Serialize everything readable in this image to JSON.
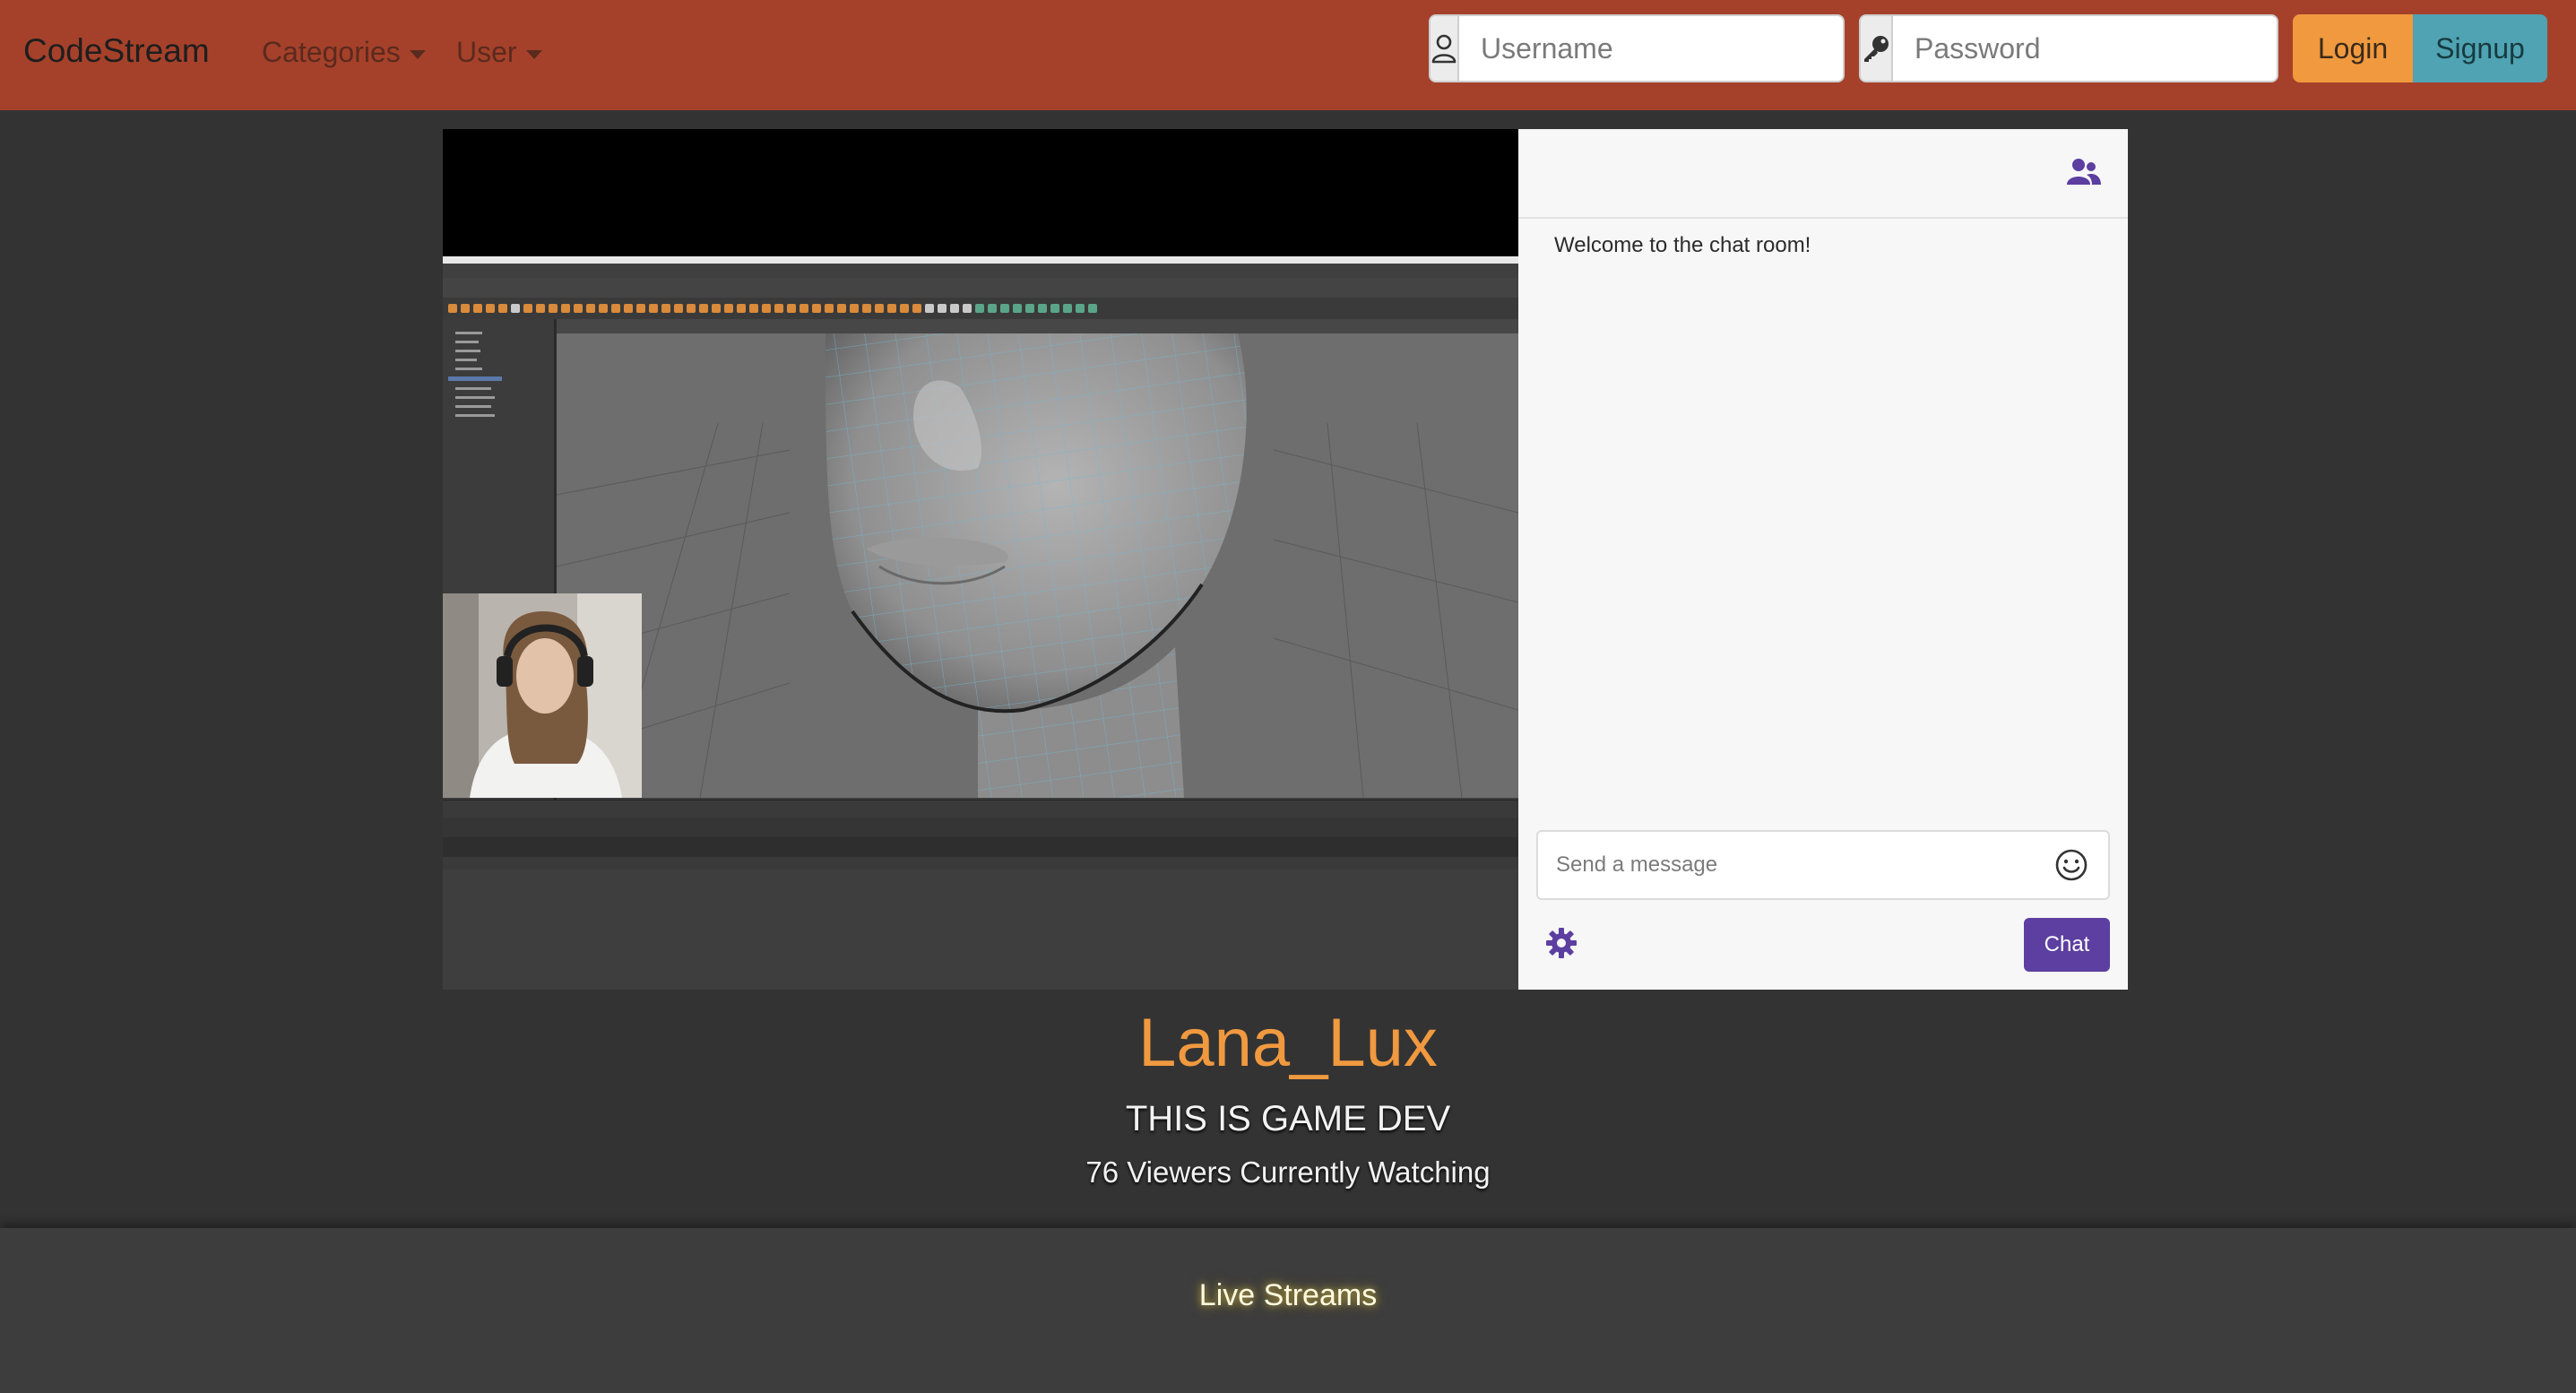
{
  "navbar": {
    "brand": "CodeStream",
    "categories_label": "Categories",
    "user_label": "User",
    "username_placeholder": "Username",
    "password_placeholder": "Password",
    "login_label": "Login",
    "signup_label": "Signup",
    "bg_color": "#a5412a"
  },
  "chat": {
    "welcome": "Welcome to the chat room!",
    "input_placeholder": "Send a message",
    "send_label": "Chat",
    "accent_color": "#5c3fa0"
  },
  "stream": {
    "streamer": "Lana_Lux",
    "title": "THIS IS GAME DEV",
    "viewers": "76 Viewers Currently Watching"
  },
  "footer": {
    "section_title": "Live Streams"
  },
  "icons": [
    "user-icon",
    "key-icon",
    "users-icon",
    "smiley-icon",
    "gear-icon"
  ]
}
